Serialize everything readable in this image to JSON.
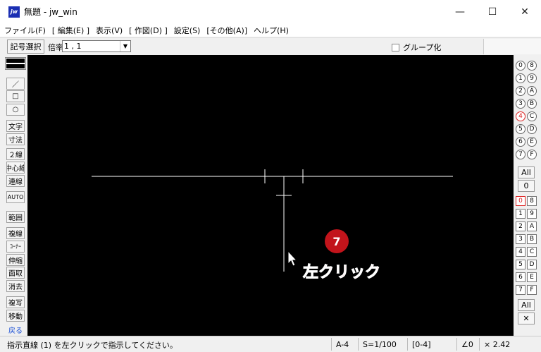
{
  "window": {
    "app_icon_text": "jw",
    "title": "無題 - jw_win",
    "minimize_glyph": "—",
    "maximize_glyph": "☐",
    "close_glyph": "✕"
  },
  "menu": [
    "ファイル(F)",
    "[ 編集(E) ]",
    "表示(V)",
    "[ 作図(D) ]",
    "設定(S)",
    "[その他(A)]",
    "ヘルプ(H)"
  ],
  "toolbar": {
    "kigo_button": "記号選択",
    "bairitsu_label": "倍率",
    "bairitsu_value": "1 , 1",
    "group_checkbox_label": "グループ化"
  },
  "left_tools": [
    "／",
    "□",
    "○",
    "文字",
    "寸法",
    "２線",
    "中心線",
    "連線",
    "AUTO",
    "範囲",
    "複線",
    "ｺｰﾅｰ",
    "伸縮",
    "面取",
    "消去",
    "複写",
    "移動",
    "戻る"
  ],
  "right_panel": {
    "layer_group_rows": [
      [
        "0",
        "8"
      ],
      [
        "1",
        "9"
      ],
      [
        "2",
        "A"
      ],
      [
        "3",
        "B"
      ],
      [
        "4",
        "C"
      ],
      [
        "5",
        "D"
      ],
      [
        "6",
        "E"
      ],
      [
        "7",
        "F"
      ]
    ],
    "active_layer_group": "4",
    "all_button": "All",
    "zero_button": "0",
    "layer_rows": [
      [
        "0",
        "8"
      ],
      [
        "1",
        "9"
      ],
      [
        "2",
        "A"
      ],
      [
        "3",
        "B"
      ],
      [
        "4",
        "C"
      ],
      [
        "5",
        "D"
      ],
      [
        "6",
        "E"
      ],
      [
        "7",
        "F"
      ]
    ],
    "active_layer": "0",
    "all_button_2": "All",
    "cross_button": "✕"
  },
  "annotation": {
    "step_number": "7",
    "instruction": "左クリック",
    "color": "#e8202a"
  },
  "statusbar": {
    "message": "指示直線 (1) を左クリックで指示してください。",
    "paper": "A-4",
    "scale": "S=1/100",
    "layer": "[0-4]",
    "angle": "∠0",
    "zoom": "× 2.42"
  }
}
